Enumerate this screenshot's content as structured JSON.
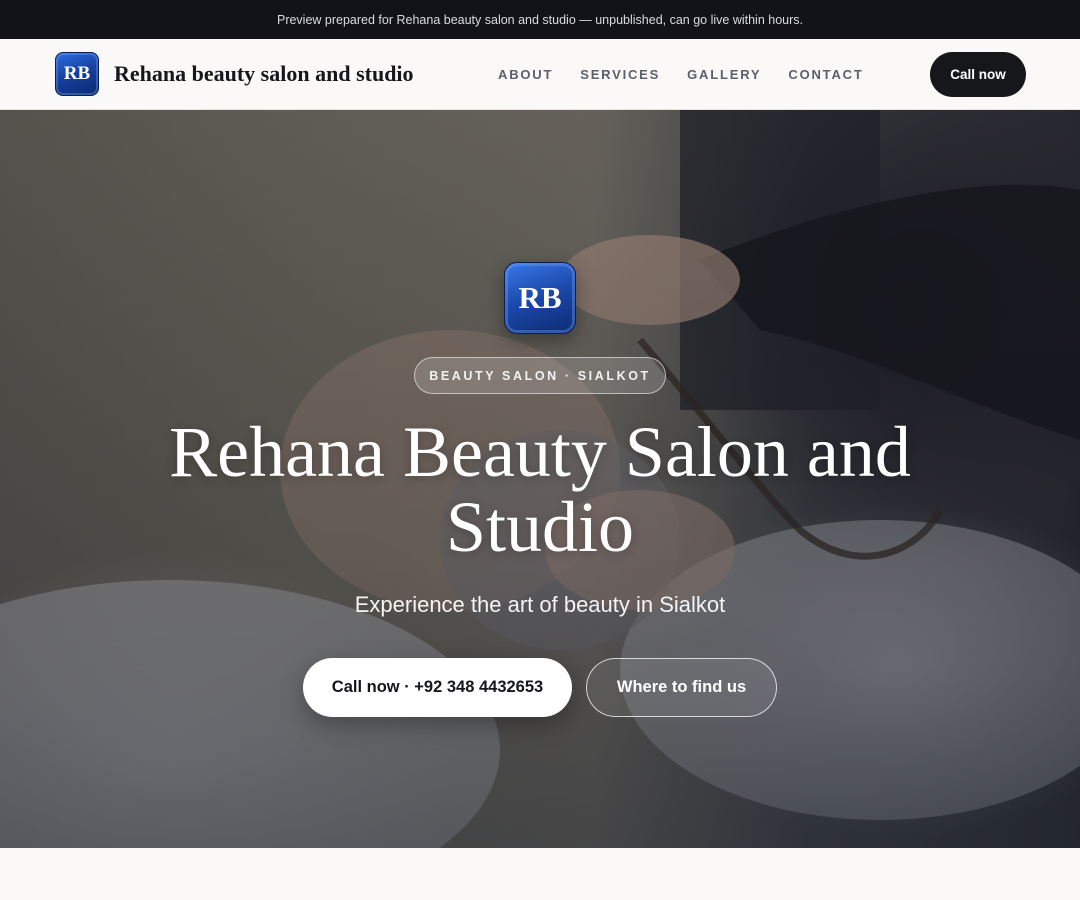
{
  "announcement": {
    "text": "Preview prepared for Rehana beauty salon and studio — unpublished, can go live within hours."
  },
  "header": {
    "logo_initials": "RB",
    "brand_name": "Rehana beauty salon and studio",
    "nav": [
      {
        "label": "ABOUT"
      },
      {
        "label": "SERVICES"
      },
      {
        "label": "GALLERY"
      },
      {
        "label": "CONTACT"
      }
    ],
    "call_label": "Call now"
  },
  "hero": {
    "logo_initials": "RB",
    "tag": "BEAUTY SALON · SIALKOT",
    "title": "Rehana Beauty Salon and Studio",
    "subtitle": "Experience the art of beauty in Sialkot",
    "primary_button": "Call now · +92 348 4432653",
    "secondary_button": "Where to find us"
  },
  "colors": {
    "dark": "#16171b",
    "announce_bg": "#111318",
    "page_bg": "#faf9f7",
    "logo_blue": "#1a47a8"
  }
}
